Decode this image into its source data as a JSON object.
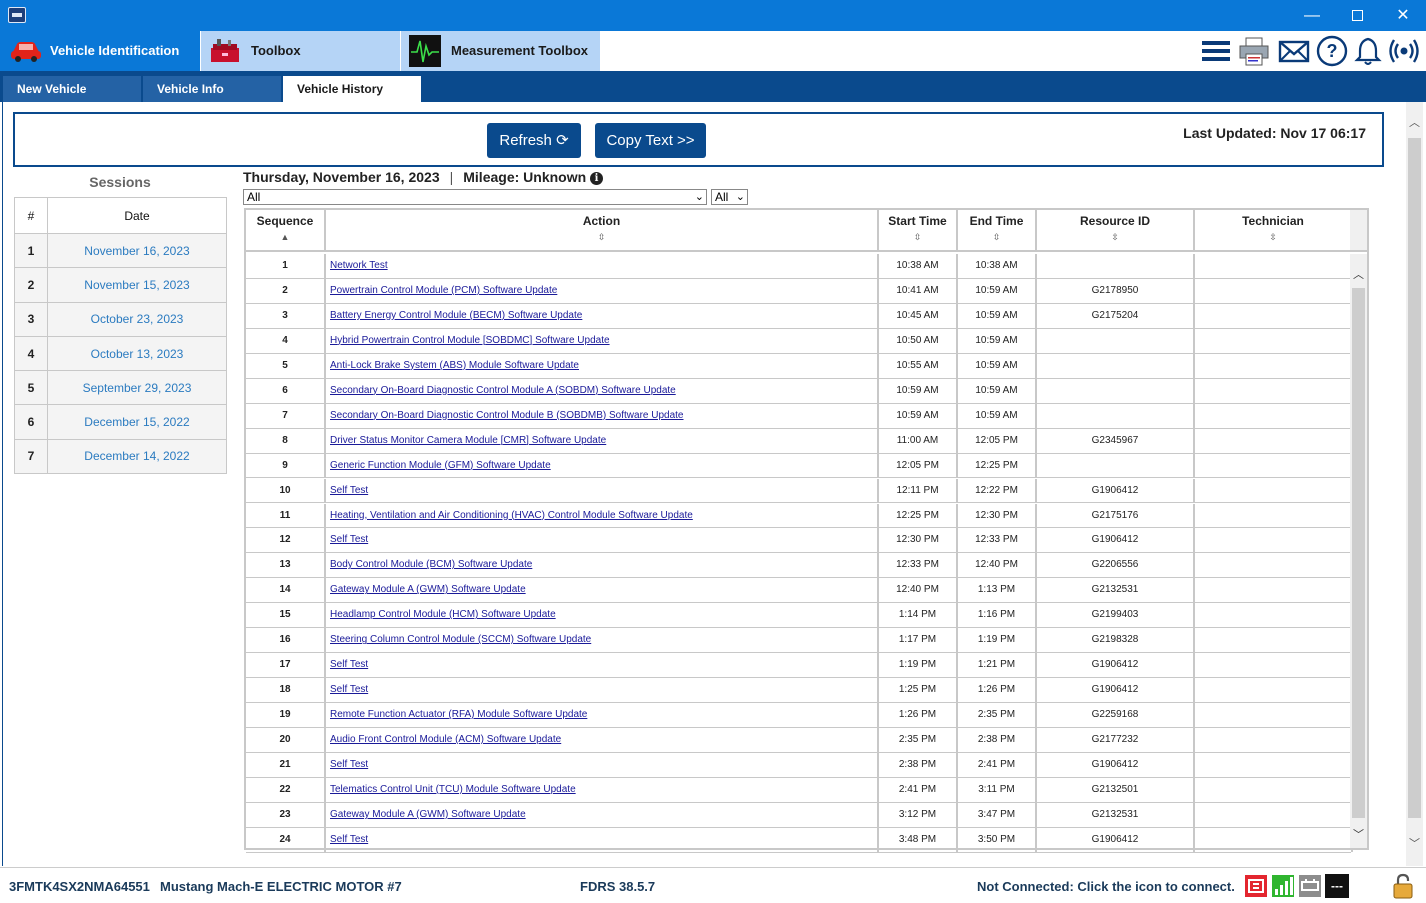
{
  "window": {
    "minimize_glyph": "—",
    "close_glyph": "✕"
  },
  "modules": [
    {
      "label": "Vehicle Identification",
      "icon": "car-icon"
    },
    {
      "label": "Toolbox",
      "icon": "toolbox-icon"
    },
    {
      "label": "Measurement Toolbox",
      "icon": "waveform-icon"
    }
  ],
  "header_icons": [
    "menu-icon",
    "printer-icon",
    "mail-icon",
    "help-icon",
    "bell-icon",
    "broadcast-icon"
  ],
  "subtabs": {
    "new_vehicle": "New Vehicle",
    "vehicle_info": "Vehicle Info",
    "vehicle_history": "Vehicle History"
  },
  "toolbar": {
    "refresh_label": "Refresh",
    "copy_label": "Copy Text >>",
    "last_updated": "Last Updated: Nov 17 06:17"
  },
  "sessions": {
    "title": "Sessions",
    "col_num": "#",
    "col_date": "Date",
    "rows": [
      {
        "num": "1",
        "date": "November 16, 2023"
      },
      {
        "num": "2",
        "date": "November 15, 2023"
      },
      {
        "num": "3",
        "date": "October 23, 2023"
      },
      {
        "num": "4",
        "date": "October 13, 2023"
      },
      {
        "num": "5",
        "date": "September 29, 2023"
      },
      {
        "num": "6",
        "date": "December 15, 2022"
      },
      {
        "num": "7",
        "date": "December 14, 2022"
      }
    ]
  },
  "history": {
    "date": "Thursday, November 16, 2023",
    "separator": "|",
    "mileage": "Mileage: Unknown",
    "filter1": "All",
    "filter2": "All",
    "columns": {
      "sequence": "Sequence",
      "action": "Action",
      "start": "Start Time",
      "end": "End Time",
      "resource": "Resource ID",
      "technician": "Technician"
    },
    "rows": [
      {
        "seq": "1",
        "action": "Network Test",
        "start": "10:38 AM",
        "end": "10:38 AM",
        "res": ""
      },
      {
        "seq": "2",
        "action": "Powertrain Control Module (PCM) Software Update",
        "start": "10:41 AM",
        "end": "10:59 AM",
        "res": "G2178950"
      },
      {
        "seq": "3",
        "action": "Battery Energy Control Module (BECM) Software Update",
        "start": "10:45 AM",
        "end": "10:59 AM",
        "res": "G2175204"
      },
      {
        "seq": "4",
        "action": "Hybrid Powertrain Control Module [SOBDMC] Software Update",
        "start": "10:50 AM",
        "end": "10:59 AM",
        "res": ""
      },
      {
        "seq": "5",
        "action": "Anti-Lock Brake System (ABS) Module Software Update",
        "start": "10:55 AM",
        "end": "10:59 AM",
        "res": ""
      },
      {
        "seq": "6",
        "action": "Secondary On-Board Diagnostic Control Module A (SOBDM) Software Update",
        "start": "10:59 AM",
        "end": "10:59 AM",
        "res": ""
      },
      {
        "seq": "7",
        "action": "Secondary On-Board Diagnostic Control Module B (SOBDMB) Software Update",
        "start": "10:59 AM",
        "end": "10:59 AM",
        "res": ""
      },
      {
        "seq": "8",
        "action": "Driver Status Monitor Camera Module [CMR] Software Update",
        "start": "11:00 AM",
        "end": "12:05 PM",
        "res": "G2345967"
      },
      {
        "seq": "9",
        "action": "Generic Function Module (GFM) Software Update",
        "start": "12:05 PM",
        "end": "12:25 PM",
        "res": ""
      },
      {
        "seq": "10",
        "action": "Self Test",
        "start": "12:11 PM",
        "end": "12:22 PM",
        "res": "G1906412"
      },
      {
        "seq": "11",
        "action": "Heating, Ventilation and Air Conditioning (HVAC) Control Module Software Update",
        "start": "12:25 PM",
        "end": "12:30 PM",
        "res": "G2175176"
      },
      {
        "seq": "12",
        "action": "Self Test",
        "start": "12:30 PM",
        "end": "12:33 PM",
        "res": "G1906412"
      },
      {
        "seq": "13",
        "action": "Body Control Module (BCM) Software Update",
        "start": "12:33 PM",
        "end": "12:40 PM",
        "res": "G2206556"
      },
      {
        "seq": "14",
        "action": "Gateway Module A (GWM) Software Update",
        "start": "12:40 PM",
        "end": "1:13 PM",
        "res": "G2132531"
      },
      {
        "seq": "15",
        "action": "Headlamp Control Module (HCM) Software Update",
        "start": "1:14 PM",
        "end": "1:16 PM",
        "res": "G2199403"
      },
      {
        "seq": "16",
        "action": "Steering Column Control Module (SCCM) Software Update",
        "start": "1:17 PM",
        "end": "1:19 PM",
        "res": "G2198328"
      },
      {
        "seq": "17",
        "action": "Self Test",
        "start": "1:19 PM",
        "end": "1:21 PM",
        "res": "G1906412"
      },
      {
        "seq": "18",
        "action": "Self Test",
        "start": "1:25 PM",
        "end": "1:26 PM",
        "res": "G1906412"
      },
      {
        "seq": "19",
        "action": "Remote Function Actuator (RFA) Module Software Update",
        "start": "1:26 PM",
        "end": "2:35 PM",
        "res": "G2259168"
      },
      {
        "seq": "20",
        "action": "Audio Front Control Module (ACM) Software Update",
        "start": "2:35 PM",
        "end": "2:38 PM",
        "res": "G2177232"
      },
      {
        "seq": "21",
        "action": "Self Test",
        "start": "2:38 PM",
        "end": "2:41 PM",
        "res": "G1906412"
      },
      {
        "seq": "22",
        "action": "Telematics Control Unit (TCU) Module Software Update",
        "start": "2:41 PM",
        "end": "3:11 PM",
        "res": "G2132501"
      },
      {
        "seq": "23",
        "action": "Gateway Module A (GWM) Software Update",
        "start": "3:12 PM",
        "end": "3:47 PM",
        "res": "G2132531"
      },
      {
        "seq": "24",
        "action": "Self Test",
        "start": "3:48 PM",
        "end": "3:50 PM",
        "res": "G1906412"
      }
    ]
  },
  "statusbar": {
    "vin": "3FMTK4SX2NMA64551",
    "model": "Mustang Mach-E ELECTRIC MOTOR #7",
    "version": "FDRS 38.5.7",
    "connection": "Not Connected: Click the icon to connect.",
    "dash_label": "---"
  },
  "colors": {
    "title_bar": "#0a78d7",
    "nav_dark": "#0a4a8d",
    "module_inactive": "#b5d4f6",
    "link": "#1a1a99",
    "session_date": "#2b7bc0"
  }
}
